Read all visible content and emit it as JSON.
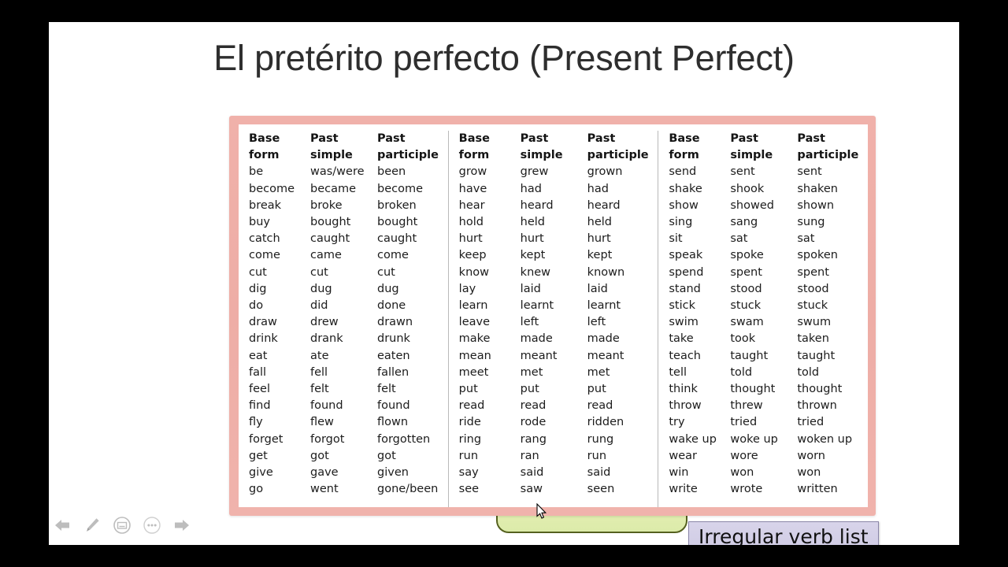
{
  "slide": {
    "title": "El pretérito perfecto (Present Perfect)",
    "callout_label": "Irregular verb list"
  },
  "table": {
    "headers": {
      "base_line1": "Base",
      "base_line2": "form",
      "past_simple_line1": "Past",
      "past_simple_line2": "simple",
      "participle_line1": "Past",
      "participle_line2": "participle"
    },
    "blocks": [
      {
        "id": "block-1",
        "rows": [
          {
            "base": "be",
            "past": "was/were",
            "participle": "been"
          },
          {
            "base": "become",
            "past": "became",
            "participle": "become"
          },
          {
            "base": "break",
            "past": "broke",
            "participle": "broken"
          },
          {
            "base": "buy",
            "past": "bought",
            "participle": "bought"
          },
          {
            "base": "catch",
            "past": "caught",
            "participle": "caught"
          },
          {
            "base": "come",
            "past": "came",
            "participle": "come"
          },
          {
            "base": "cut",
            "past": "cut",
            "participle": "cut"
          },
          {
            "base": "dig",
            "past": "dug",
            "participle": "dug"
          },
          {
            "base": "do",
            "past": "did",
            "participle": "done"
          },
          {
            "base": "draw",
            "past": "drew",
            "participle": "drawn"
          },
          {
            "base": "drink",
            "past": "drank",
            "participle": "drunk"
          },
          {
            "base": "eat",
            "past": "ate",
            "participle": "eaten"
          },
          {
            "base": "fall",
            "past": "fell",
            "participle": "fallen"
          },
          {
            "base": "feel",
            "past": "felt",
            "participle": "felt"
          },
          {
            "base": "find",
            "past": "found",
            "participle": "found"
          },
          {
            "base": "fly",
            "past": "flew",
            "participle": "flown"
          },
          {
            "base": "forget",
            "past": "forgot",
            "participle": "forgotten"
          },
          {
            "base": "get",
            "past": "got",
            "participle": "got"
          },
          {
            "base": "give",
            "past": "gave",
            "participle": "given"
          },
          {
            "base": "go",
            "past": "went",
            "participle": "gone/been"
          }
        ]
      },
      {
        "id": "block-2",
        "rows": [
          {
            "base": "grow",
            "past": "grew",
            "participle": "grown"
          },
          {
            "base": "have",
            "past": "had",
            "participle": "had"
          },
          {
            "base": "hear",
            "past": "heard",
            "participle": "heard"
          },
          {
            "base": "hold",
            "past": "held",
            "participle": "held"
          },
          {
            "base": "hurt",
            "past": "hurt",
            "participle": "hurt"
          },
          {
            "base": "keep",
            "past": "kept",
            "participle": "kept"
          },
          {
            "base": "know",
            "past": "knew",
            "participle": "known"
          },
          {
            "base": "lay",
            "past": "laid",
            "participle": "laid"
          },
          {
            "base": "learn",
            "past": "learnt",
            "participle": "learnt"
          },
          {
            "base": "leave",
            "past": "left",
            "participle": "left"
          },
          {
            "base": "make",
            "past": "made",
            "participle": "made"
          },
          {
            "base": "mean",
            "past": "meant",
            "participle": "meant"
          },
          {
            "base": "meet",
            "past": "met",
            "participle": "met"
          },
          {
            "base": "put",
            "past": "put",
            "participle": "put"
          },
          {
            "base": "read",
            "past": "read",
            "participle": "read"
          },
          {
            "base": "ride",
            "past": "rode",
            "participle": "ridden"
          },
          {
            "base": "ring",
            "past": "rang",
            "participle": "rung"
          },
          {
            "base": "run",
            "past": "ran",
            "participle": "run"
          },
          {
            "base": "say",
            "past": "said",
            "participle": "said"
          },
          {
            "base": "see",
            "past": "saw",
            "participle": "seen"
          }
        ]
      },
      {
        "id": "block-3",
        "rows": [
          {
            "base": "send",
            "past": "sent",
            "participle": "sent"
          },
          {
            "base": "shake",
            "past": "shook",
            "participle": "shaken"
          },
          {
            "base": "show",
            "past": "showed",
            "participle": "shown"
          },
          {
            "base": "sing",
            "past": "sang",
            "participle": "sung"
          },
          {
            "base": "sit",
            "past": "sat",
            "participle": "sat"
          },
          {
            "base": "speak",
            "past": "spoke",
            "participle": "spoken"
          },
          {
            "base": "spend",
            "past": "spent",
            "participle": "spent"
          },
          {
            "base": "stand",
            "past": "stood",
            "participle": "stood"
          },
          {
            "base": "stick",
            "past": "stuck",
            "participle": "stuck"
          },
          {
            "base": "swim",
            "past": "swam",
            "participle": "swum"
          },
          {
            "base": "take",
            "past": "took",
            "participle": "taken"
          },
          {
            "base": "teach",
            "past": "taught",
            "participle": "taught"
          },
          {
            "base": "tell",
            "past": "told",
            "participle": "told"
          },
          {
            "base": "think",
            "past": "thought",
            "participle": "thought"
          },
          {
            "base": "throw",
            "past": "threw",
            "participle": "thrown"
          },
          {
            "base": "try",
            "past": "tried",
            "participle": "tried"
          },
          {
            "base": "wake up",
            "past": "woke up",
            "participle": "woken up"
          },
          {
            "base": "wear",
            "past": "wore",
            "participle": "worn"
          },
          {
            "base": "win",
            "past": "won",
            "participle": "won"
          },
          {
            "base": "write",
            "past": "wrote",
            "participle": "written"
          }
        ]
      }
    ]
  },
  "toolbar": {
    "items": [
      {
        "icon": "previous-arrow-icon",
        "label": "Previous"
      },
      {
        "icon": "pencil-icon",
        "label": "Draw"
      },
      {
        "icon": "notes-icon",
        "label": "Notes"
      },
      {
        "icon": "more-options-icon",
        "label": "More options"
      },
      {
        "icon": "next-arrow-icon",
        "label": "Next"
      }
    ]
  },
  "colors": {
    "frame_pink": "#eeada6",
    "callout_lavender": "#d2cee6",
    "green_shape": "#e0ecad",
    "letterbox_black": "#000000"
  }
}
